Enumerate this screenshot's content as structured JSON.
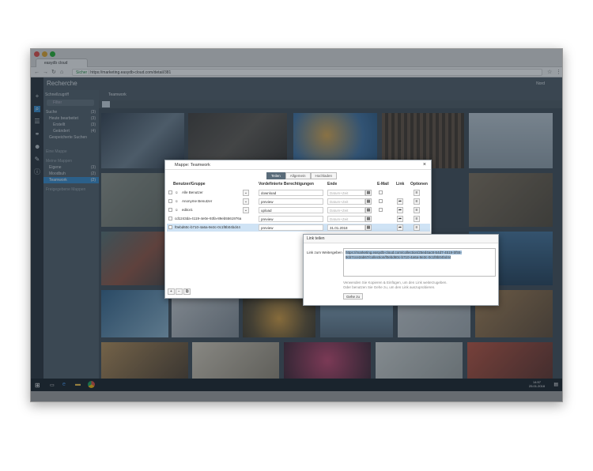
{
  "browser": {
    "tab_title": "easydb cloud",
    "secure_label": "Sicher",
    "url": "https://marketing.easydb-cloud.com/detail/381"
  },
  "app": {
    "header_title": "Recherche",
    "header_right": "Nord",
    "search_label": "Schnellzugriff",
    "filter_placeholder": "Filter",
    "collection_title": "Teamwork"
  },
  "sidebar": {
    "items": [
      {
        "label": "Suche",
        "count": "(3)"
      },
      {
        "label": "Heute bearbeitet",
        "count": "(3)"
      },
      {
        "label": "Erstellt",
        "count": "(3)"
      },
      {
        "label": "Geändert",
        "count": "(4)"
      },
      {
        "label": "Gespeicherte Suchen",
        "count": ""
      },
      {
        "label": "Eine Mappe",
        "count": ""
      },
      {
        "label": "Meine Mappen",
        "count": ""
      },
      {
        "label": "Eigene",
        "count": "(3)"
      },
      {
        "label": "Moodbuh",
        "count": "(2)"
      },
      {
        "label": "Teamwork",
        "count": "(2)"
      },
      {
        "label": "Freigegebene Mappen",
        "count": ""
      }
    ]
  },
  "dialog": {
    "title": "Mappe: Teamwork",
    "tabs": [
      "Teilen",
      "Allgemein",
      "Hochladen"
    ],
    "columns": [
      "Benutzer/Gruppe",
      "Vordefinierte Berechtigungen",
      "Ende",
      "E-Mail",
      "Link",
      "Optionen"
    ],
    "date_placeholder": "Datum+Zeit",
    "rows": [
      {
        "user": "Alle Benutzer",
        "perm": "download",
        "end": "",
        "selected": false
      },
      {
        "user": "Anonyme Benutzer",
        "perm": "preview",
        "end": "",
        "selected": false
      },
      {
        "user": "editor1",
        "perm": "upload",
        "end": "",
        "selected": false
      },
      {
        "user": "cd1243da-4119-4e0e-93fa-89eb5561976a",
        "perm": "preview",
        "end": "",
        "selected": false
      },
      {
        "user": "f0ebd60c-b710-4a6a-9e3c-0c1f8b04bd44",
        "perm": "preview",
        "end": "31.01.2018",
        "selected": true
      }
    ],
    "footer_add": "+",
    "footer_remove": "−",
    "footer_copy": "⧉"
  },
  "share": {
    "title": "Link teilen",
    "label": "Link zum Weitergeben",
    "url": "https://marketing.easydb-cloud.com/collection/25ed4ac8-54d7-4519-bf55-9cb7cce2ab67/collection/f0ebd60c-b710-4a6a-9e3c-0c1f8b04bd44",
    "help_line1": "Verwenden Sie Kopieren & Einfügen, um den Link weiterzugeben.",
    "help_line2": "Oder benutzen Sie Gehe zu, um den Link auszuprobieren.",
    "goto_button": "Gehe zu"
  },
  "taskbar": {
    "time": "14:57",
    "date": "25.01.2018"
  },
  "colors": {
    "app_bg": "#3d4953",
    "sidebar": "#4b5964",
    "accent": "#5a6c7a",
    "selected_row": "#cfe3f5"
  }
}
